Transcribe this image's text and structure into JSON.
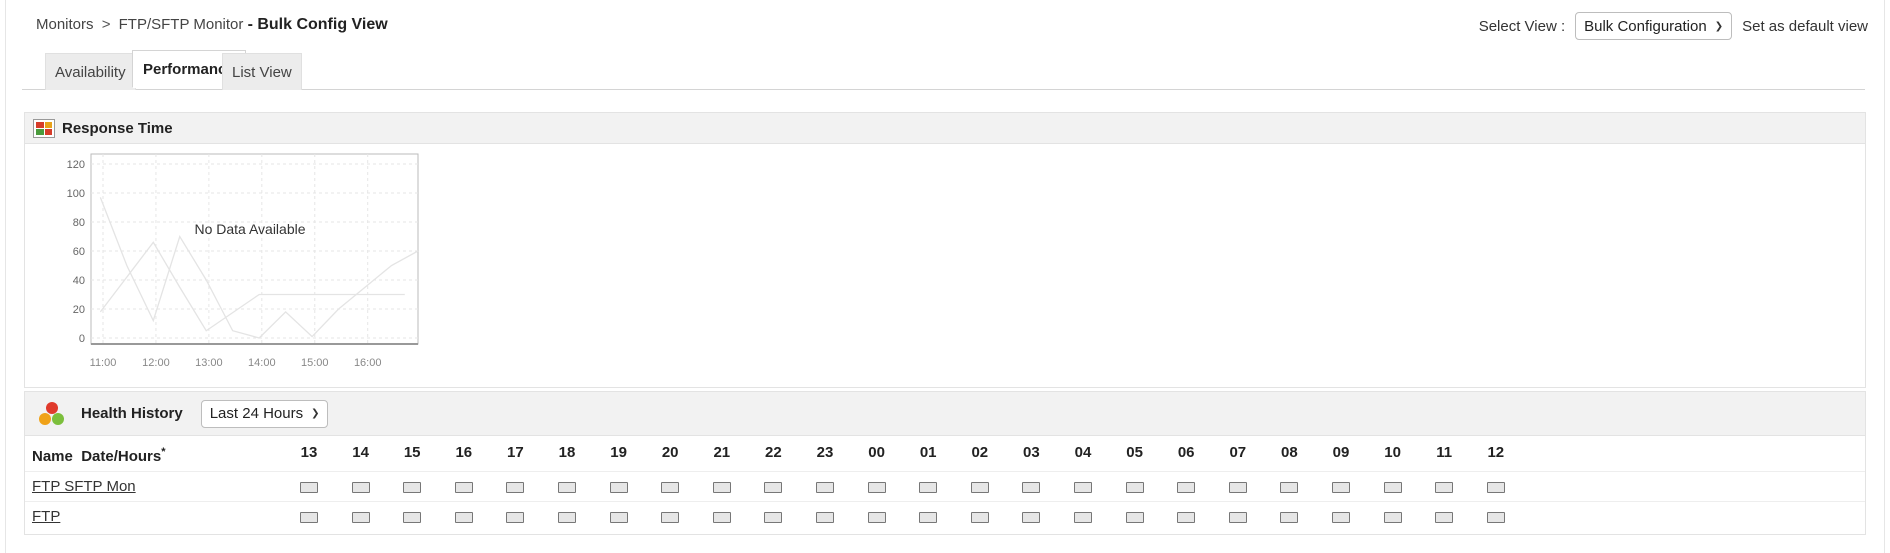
{
  "breadcrumb": {
    "monitors": "Monitors",
    "separator": ">",
    "monitor_type": "FTP/SFTP Monitor",
    "page_title": "- Bulk Config View"
  },
  "select_view": {
    "label": "Select View :",
    "value": "Bulk Configuration",
    "default_link": "Set as default view"
  },
  "tabs": [
    {
      "label": "Availability"
    },
    {
      "label": "Performance"
    },
    {
      "label": "List View"
    }
  ],
  "active_tab": "Performance",
  "response_time": {
    "title": "Response Time",
    "no_data": "No Data Available"
  },
  "chart_data": {
    "type": "line",
    "title": "",
    "xlabel": "",
    "ylabel": "",
    "ylim": [
      0,
      120
    ],
    "yticks": [
      "120",
      "100",
      "80",
      "60",
      "40",
      "20",
      "0"
    ],
    "xticks": [
      "11:00",
      "12:00",
      "13:00",
      "14:00",
      "15:00",
      "16:00"
    ],
    "placeholder_series": [
      {
        "x": [
          10.95,
          11.45,
          11.95,
          12.45,
          12.95,
          13.45,
          13.95,
          14.45,
          14.95,
          15.45,
          15.95,
          16.45,
          16.95
        ],
        "values": [
          97,
          50,
          12,
          70,
          40,
          5,
          0,
          18,
          1,
          20,
          35,
          50,
          60
        ]
      },
      {
        "x": [
          10.95,
          11.95,
          12.45,
          12.95,
          13.95,
          14.95,
          15.95,
          16.7
        ],
        "values": [
          18,
          66,
          35,
          5,
          30,
          30,
          30,
          30
        ]
      }
    ],
    "grid": true
  },
  "health_history": {
    "title": "Health History",
    "period": "Last 24 Hours",
    "name_header": "Name",
    "date_header": "Date/Hours",
    "hours": [
      "13",
      "14",
      "15",
      "16",
      "17",
      "18",
      "19",
      "20",
      "21",
      "22",
      "23",
      "00",
      "01",
      "02",
      "03",
      "04",
      "05",
      "06",
      "07",
      "08",
      "09",
      "10",
      "11",
      "12"
    ],
    "rows": [
      {
        "name": "FTP SFTP Mon"
      },
      {
        "name": "FTP"
      }
    ]
  },
  "colors": {
    "header_bg": "#f2f2f2",
    "border": "#e3e3e3",
    "status_unknown": "#e6e6e6"
  }
}
